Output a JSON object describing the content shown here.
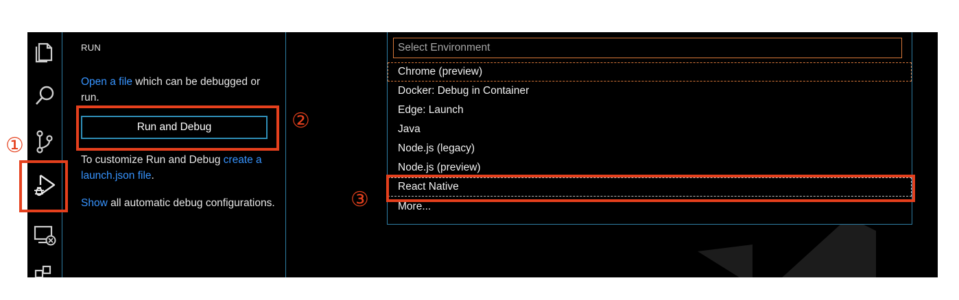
{
  "activity_bar": {
    "items": [
      {
        "icon": "files-icon"
      },
      {
        "icon": "search-icon"
      },
      {
        "icon": "source-control-icon"
      },
      {
        "icon": "run-debug-icon",
        "active": true
      },
      {
        "icon": "remote-explorer-icon"
      },
      {
        "icon": "extensions-icon"
      }
    ]
  },
  "run_panel": {
    "title": "RUN",
    "open_file_link": "Open a file",
    "open_file_rest": " which can be debugged or run.",
    "run_button_label": "Run and Debug",
    "customize_text": "To customize Run and Debug ",
    "launch_json_link": "create a launch.json file",
    "launch_json_suffix": ".",
    "show_link": "Show",
    "show_rest": " all automatic debug configurations."
  },
  "environment_picker": {
    "placeholder": "Select Environment",
    "options": [
      "Chrome (preview)",
      "Docker: Debug in Container",
      "Edge: Launch",
      "Java",
      "Node.js (legacy)",
      "Node.js (preview)",
      "React Native",
      "More..."
    ],
    "focused_option": "Chrome (preview)",
    "selected_option": "React Native"
  },
  "annotations": {
    "step1": "①",
    "step2": "②",
    "step3": "③"
  },
  "colors": {
    "highlight_red": "#e5401d",
    "focus_orange": "#d9783a",
    "panel_border": "#2f7fa6",
    "link_blue": "#3794ff",
    "background": "#000000"
  }
}
